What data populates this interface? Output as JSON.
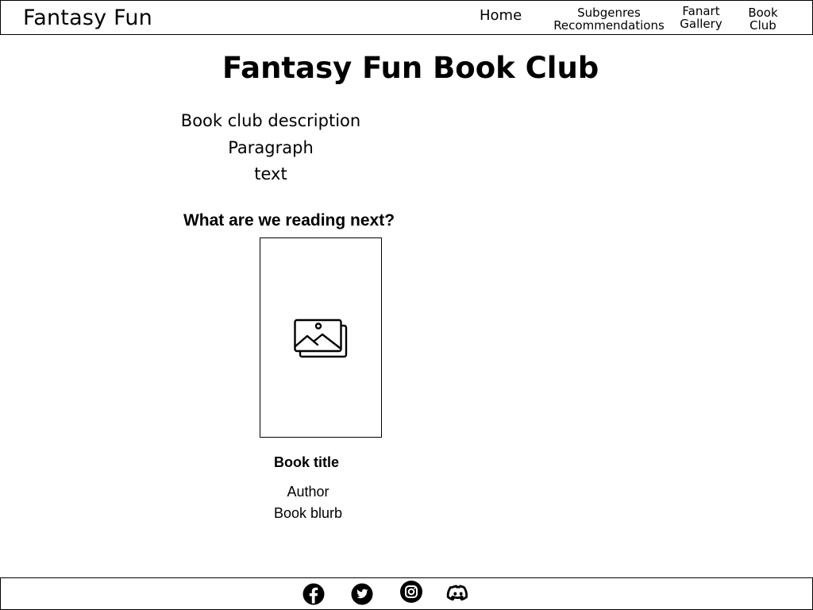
{
  "header": {
    "brand": "Fantasy Fun",
    "nav": {
      "home": "Home",
      "subgenres_line1": "Subgenres",
      "subgenres_line2": "Recommendations",
      "fanart_line1": "Fanart",
      "fanart_line2": "Gallery",
      "bookclub_line1": "Book",
      "bookclub_line2": "Club"
    }
  },
  "main": {
    "title": "Fantasy Fun Book Club",
    "description_lines": [
      "Book club description",
      "Paragraph",
      "text"
    ],
    "next_heading": "What are we reading next?",
    "book": {
      "cover_icon": "image-placeholder-icon",
      "title": "Book title",
      "author": "Author",
      "blurb": "Book blurb"
    }
  },
  "footer": {
    "social_icons": [
      "facebook-icon",
      "twitter-icon",
      "instagram-icon",
      "discord-icon"
    ]
  },
  "colors": {
    "foreground": "#000000",
    "background": "#ffffff"
  }
}
